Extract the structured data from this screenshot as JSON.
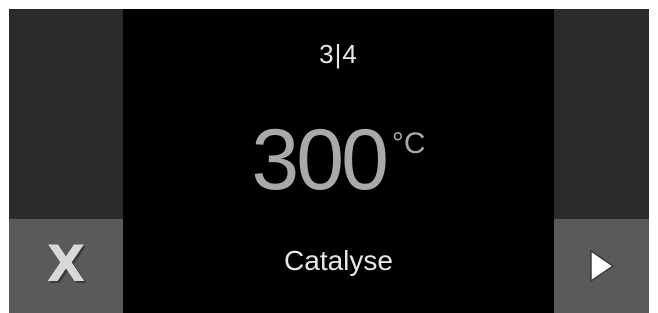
{
  "screen": {
    "step_indicator": "3|4",
    "temperature": {
      "value": "300",
      "unit": "°C"
    },
    "program_name": "Catalyse"
  },
  "buttons": {
    "close_label": "X",
    "next_icon": "play-right-icon"
  },
  "colors": {
    "background": "#000000",
    "side_panel": "#2b2b2b",
    "button": "#5a5a5a",
    "temperature_text": "#a9a9a9",
    "text": "#e6e6e6"
  }
}
